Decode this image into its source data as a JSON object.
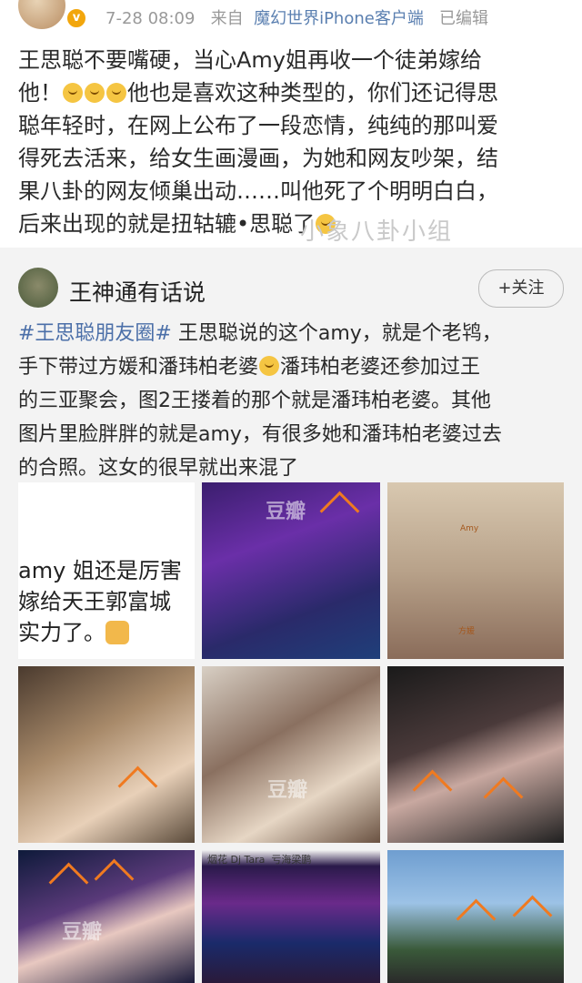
{
  "post": {
    "time": "7-28 08:09",
    "source_prefix": "来自",
    "source_client": "魔幻世界iPhone客户端",
    "edited": "已编辑",
    "text_line1": "王思聪不要嘴硬，当心Amy姐再收一个徒弟嫁给",
    "text_line2_a": "他！",
    "text_line2_b": "他也是喜欢这种类型的，你们还记得思",
    "text_line3": "聪年轻时，在网上公布了一段恋情，纯纯的那叫爱",
    "text_line4": "得死去活来，给女生画漫画，为她和网友吵架，结",
    "text_line5": "果八卦的网友倾巢出动……叫他死了个明明白白，",
    "text_line6": "后来出现的就是扭轱辘•思聪了",
    "watermark": "小象八卦小组"
  },
  "repost": {
    "author": "王神通有话说",
    "follow_label": "+关注",
    "hashtag": "#王思聪朋友圈#",
    "text_a": " 王思聪说的这个amy，就是个老鸨，",
    "text_line2_a": "手下带过方媛和潘玮柏老婆",
    "text_line2_b": "潘玮柏老婆还参加过王",
    "text_line3": "的三亚聚会，图2王搂着的那个就是潘玮柏老婆。其他",
    "text_line4": "图片里脸胖胖的就是amy，有很多她和潘玮柏老婆过去",
    "text_line5": "的合照。这女的很早就出来混了"
  },
  "photos": {
    "note_line1": "amy 姐还是厉害",
    "note_line2": "嫁给天王郭富城",
    "note_line3": "实力了。",
    "watermark_douban": "豆瓣",
    "watermark_group": "小象八卦",
    "photo3_label_amy": "Amy",
    "photo3_label_fangyuan": "方媛",
    "photo8_caption": "烟花 Dj Tara",
    "photo8_caption_right": "亏海梁鹏"
  },
  "colors": {
    "link_blue": "#5a7fb0",
    "hashtag_blue": "#4b6fa8",
    "arrow_orange": "#f07a20",
    "repost_bg": "#f3f3f3"
  }
}
